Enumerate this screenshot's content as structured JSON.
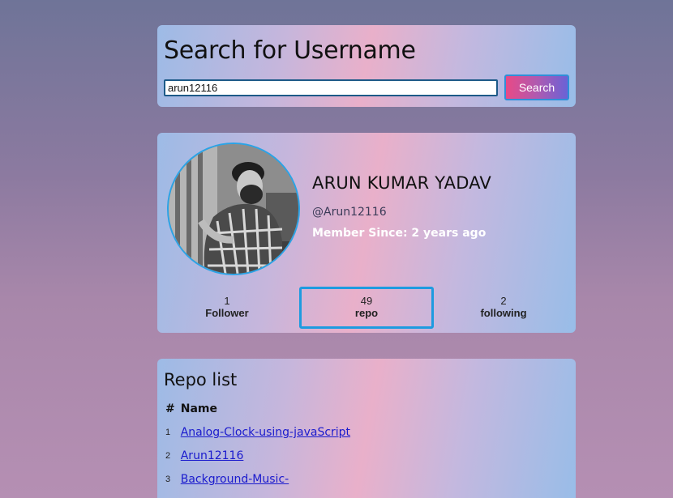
{
  "search": {
    "title": "Search for Username",
    "input_value": "arun12116",
    "button_label": "Search"
  },
  "profile": {
    "name": "ARUN KUMAR YADAV",
    "handle": "@Arun12116",
    "member_since": "Member Since: 2 years ago",
    "stats": {
      "followers": {
        "value": "1",
        "label": "Follower"
      },
      "repos": {
        "value": "49",
        "label": "repo"
      },
      "following": {
        "value": "2",
        "label": "following"
      }
    }
  },
  "repo_list": {
    "title": "Repo list",
    "headers": [
      "#",
      "Name"
    ],
    "rows": [
      {
        "index": "1",
        "name": "Analog-Clock-using-javaScript"
      },
      {
        "index": "2",
        "name": "Arun12116"
      },
      {
        "index": "3",
        "name": "Background-Music-"
      }
    ]
  },
  "colors": {
    "accent_border": "#1e9be0",
    "link": "#1a1acd",
    "button_gradient_start": "#e84a86",
    "button_gradient_end": "#6a62d6"
  }
}
